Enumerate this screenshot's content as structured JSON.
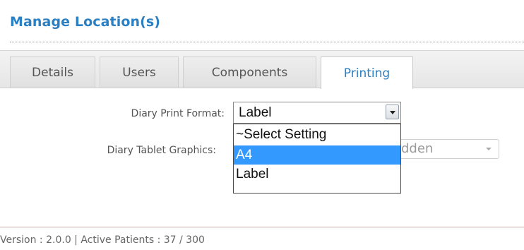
{
  "page": {
    "title": "Manage Location(s)"
  },
  "tabs": [
    {
      "label": "Details",
      "active": false
    },
    {
      "label": "Users",
      "active": false
    },
    {
      "label": "Components",
      "active": false
    },
    {
      "label": "Printing",
      "active": true
    }
  ],
  "form": {
    "diary_print_format": {
      "label": "Diary Print Format:",
      "value": "Label",
      "options": [
        "~Select Setting",
        "A4",
        "Label"
      ],
      "highlighted_option": "A4"
    },
    "diary_tablet_graphics": {
      "label": "Diary Tablet Graphics:",
      "value_partial": "dden"
    }
  },
  "footer": {
    "text": "Version : 2.0.0 | Active Patients : 37 / 300"
  },
  "colors": {
    "title": "#2b7fc3",
    "active_tab_text": "#2b7fc3",
    "highlight": "#3399ff"
  }
}
